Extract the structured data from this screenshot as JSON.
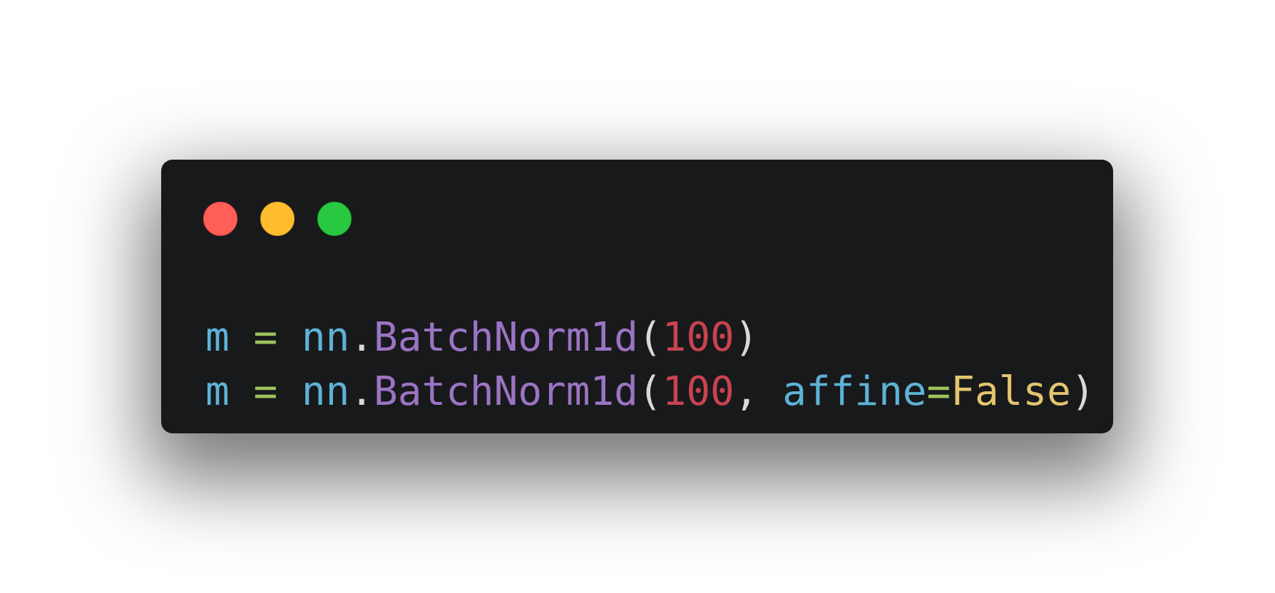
{
  "window": {
    "buttons": {
      "close": "close-icon",
      "minimize": "minimize-icon",
      "maximize": "maximize-icon"
    }
  },
  "colors": {
    "window_background": "#18191b",
    "variable": "#5db2d6",
    "operator": "#9bc45c",
    "function": "#9b74c4",
    "number": "#c8424f",
    "punctuation": "#d9d9d9",
    "keyword": "#e2c56f",
    "close": "#ff5f57",
    "minimize": "#febc2e",
    "maximize": "#28c840"
  },
  "code": {
    "lines": [
      [
        {
          "text": "m",
          "kind": "var"
        },
        {
          "text": " ",
          "kind": "punct"
        },
        {
          "text": "=",
          "kind": "op"
        },
        {
          "text": " ",
          "kind": "punct"
        },
        {
          "text": "nn",
          "kind": "var"
        },
        {
          "text": ".",
          "kind": "punct"
        },
        {
          "text": "BatchNorm1d",
          "kind": "fn"
        },
        {
          "text": "(",
          "kind": "punct"
        },
        {
          "text": "100",
          "kind": "num"
        },
        {
          "text": ")",
          "kind": "punct"
        }
      ],
      [
        {
          "text": "m",
          "kind": "var"
        },
        {
          "text": " ",
          "kind": "punct"
        },
        {
          "text": "=",
          "kind": "op"
        },
        {
          "text": " ",
          "kind": "punct"
        },
        {
          "text": "nn",
          "kind": "var"
        },
        {
          "text": ".",
          "kind": "punct"
        },
        {
          "text": "BatchNorm1d",
          "kind": "fn"
        },
        {
          "text": "(",
          "kind": "punct"
        },
        {
          "text": "100",
          "kind": "num"
        },
        {
          "text": ", ",
          "kind": "punct"
        },
        {
          "text": "affine",
          "kind": "var"
        },
        {
          "text": "=",
          "kind": "op"
        },
        {
          "text": "False",
          "kind": "kw"
        },
        {
          "text": ")",
          "kind": "punct"
        }
      ]
    ]
  }
}
